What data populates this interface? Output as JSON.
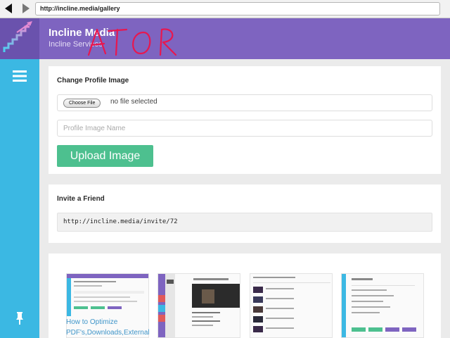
{
  "browser": {
    "url": "http://incline.media/gallery"
  },
  "header": {
    "title": "Incline Media",
    "subtitle": "Incline Services"
  },
  "profile": {
    "title": "Change Profile Image",
    "choose_label": "Choose File",
    "file_status": "no file selected",
    "name_placeholder": "Profile Image Name",
    "upload_label": "Upload Image"
  },
  "invite": {
    "title": "Invite a Friend",
    "link": "http://incline.media/invite/72"
  },
  "gallery": {
    "first_caption": "How to Optimize PDF's,Downloads,External"
  },
  "colors": {
    "header": "#7e64c0",
    "sidebar": "#3bb8e3",
    "accent_green": "#4dc08f"
  },
  "icons": {
    "back": "back-arrow-icon",
    "forward": "forward-arrow-icon",
    "logo": "staircase-logo-icon",
    "menu": "hamburger-menu-icon",
    "pin": "pushpin-icon"
  }
}
